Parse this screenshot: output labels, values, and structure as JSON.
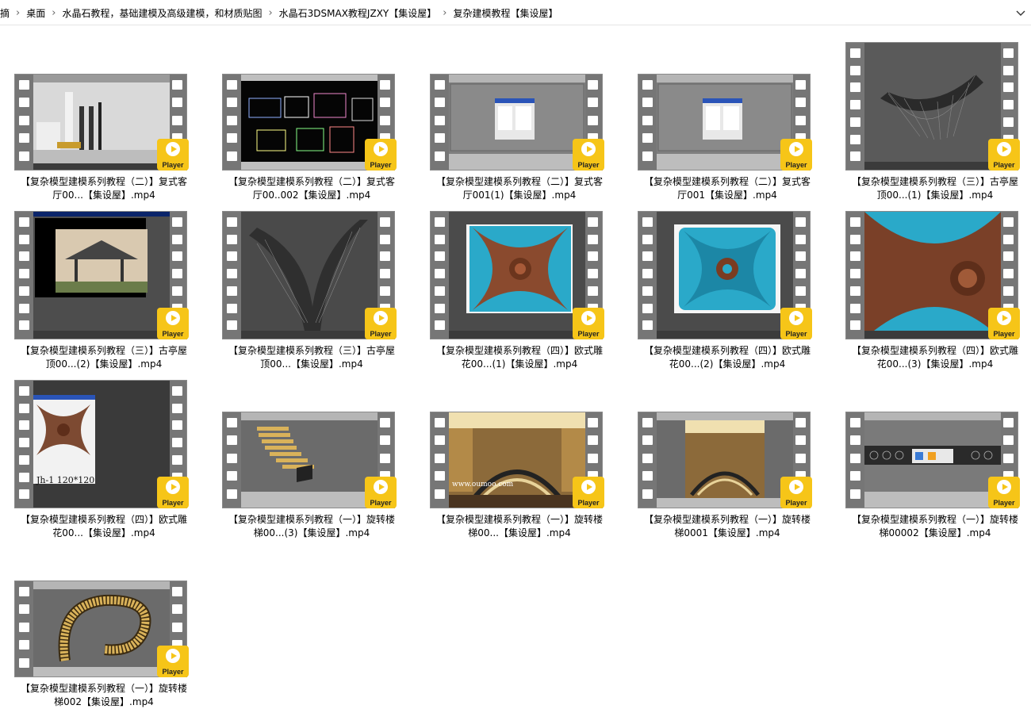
{
  "address_bar": {
    "crumbs": [
      "摘",
      "桌面",
      "水晶石教程，基础建模及高级建模，和材质贴图",
      "水晶石3DSMAX教程JZXY【集设屋】",
      "复杂建模教程【集设屋】"
    ],
    "separator": "›"
  },
  "player_label": "Player",
  "files": [
    {
      "line1": "【复杂模型建模系列教程（二）】复式客",
      "line2": "厅00...【集设屋】.mp4",
      "thumb": "room-render"
    },
    {
      "line1": "【复杂模型建模系列教程（二）】复式客",
      "line2": "厅00..002【集设屋】.mp4",
      "thumb": "cad-plans"
    },
    {
      "line1": "【复杂模型建模系列教程（二）】复式客",
      "line2": "厅001(1)【集设屋】.mp4",
      "thumb": "max-dialog"
    },
    {
      "line1": "【复杂模型建模系列教程（二）】复式客",
      "line2": "厅001【集设屋】.mp4",
      "thumb": "max-dialog"
    },
    {
      "line1": "【复杂模型建模系列教程（三）】古亭屋",
      "line2": "顶00...(1)【集设屋】.mp4",
      "thumb": "roof-fan"
    },
    {
      "line1": "【复杂模型建模系列教程（三）】古亭屋",
      "line2": "顶00...(2)【集设屋】.mp4",
      "thumb": "pavilion-photo"
    },
    {
      "line1": "【复杂模型建模系列教程（三）】古亭屋",
      "line2": "顶00...【集设屋】.mp4",
      "thumb": "roof-peak"
    },
    {
      "line1": "【复杂模型建模系列教程（四）】欧式雕",
      "line2": "花00...(1)【集设屋】.mp4",
      "thumb": "carving-bronze"
    },
    {
      "line1": "【复杂模型建模系列教程（四）】欧式雕",
      "line2": "花00...(2)【集设屋】.mp4",
      "thumb": "carving-blue"
    },
    {
      "line1": "【复杂模型建模系列教程（四）】欧式雕",
      "line2": "花00...(3)【集设屋】.mp4",
      "thumb": "carving-closeup"
    },
    {
      "line1": "【复杂模型建模系列教程（四）】欧式雕",
      "line2": "花00...【集设屋】.mp4",
      "thumb": "carving-photo",
      "caption": "Jh-1 120*120"
    },
    {
      "line1": "【复杂模型建模系列教程（一）】旋转楼",
      "line2": "梯00...(3)【集设屋】.mp4",
      "thumb": "stair-model"
    },
    {
      "line1": "【复杂模型建模系列教程（一）】旋转楼",
      "line2": "梯00...【集设屋】.mp4",
      "thumb": "stair-render",
      "caption": "www.oumoo.com"
    },
    {
      "line1": "【复杂模型建模系列教程（一）】旋转楼",
      "line2": "梯0001【集设屋】.mp4",
      "thumb": "stair-render2"
    },
    {
      "line1": "【复杂模型建模系列教程（一）】旋转楼",
      "line2": "梯00002【集设屋】.mp4",
      "thumb": "railing"
    },
    {
      "line1": "【复杂模型建模系列教程（一）】旋转楼",
      "line2": "梯002【集设屋】.mp4",
      "thumb": "spiral"
    }
  ]
}
